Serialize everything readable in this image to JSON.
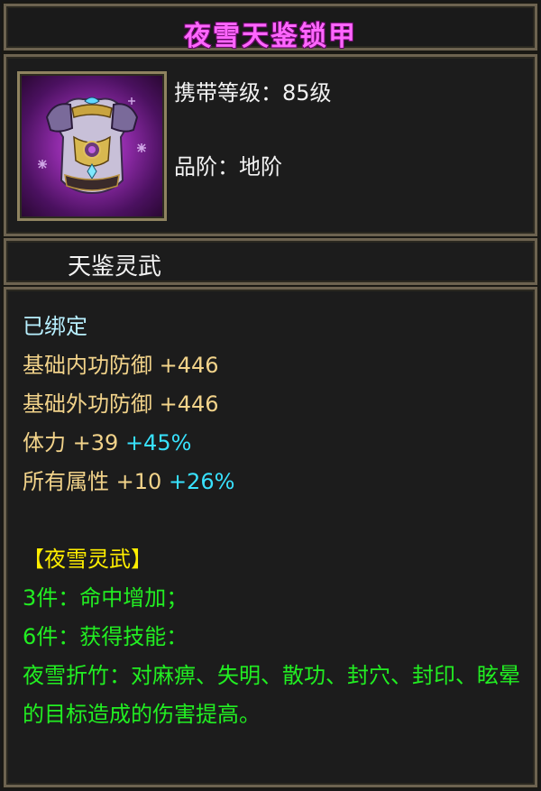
{
  "item": {
    "name": "夜雪天鉴锁甲",
    "icon": "armor-vest-icon",
    "level_label": "携带等级：",
    "level_value": "85级",
    "grade_label": "品阶：",
    "grade_value": "地阶",
    "set_name": "天鉴灵武"
  },
  "stats": {
    "bound": "已绑定",
    "inner_defense_label": "基础内功防御",
    "inner_defense_value": "+446",
    "outer_defense_label": "基础外功防御",
    "outer_defense_value": "+446",
    "stamina_label": "体力",
    "stamina_value": "+39",
    "stamina_pct": "+45%",
    "all_attr_label": "所有属性",
    "all_attr_value": "+10",
    "all_attr_pct": "+26%"
  },
  "set_bonus": {
    "title": "【夜雪灵武】",
    "piece3": "3件：命中增加；",
    "piece6": "6件：获得技能：",
    "skill_desc": "夜雪折竹：对麻痹、失明、散功、封穴、封印、眩晕的目标造成的伤害提高。"
  },
  "colors": {
    "title": "#ff66ff",
    "attr": "#f2d38a",
    "percent": "#38e2ff",
    "set_title": "#ffee00",
    "set_text": "#22ee22",
    "bound": "#b8f0ff"
  }
}
